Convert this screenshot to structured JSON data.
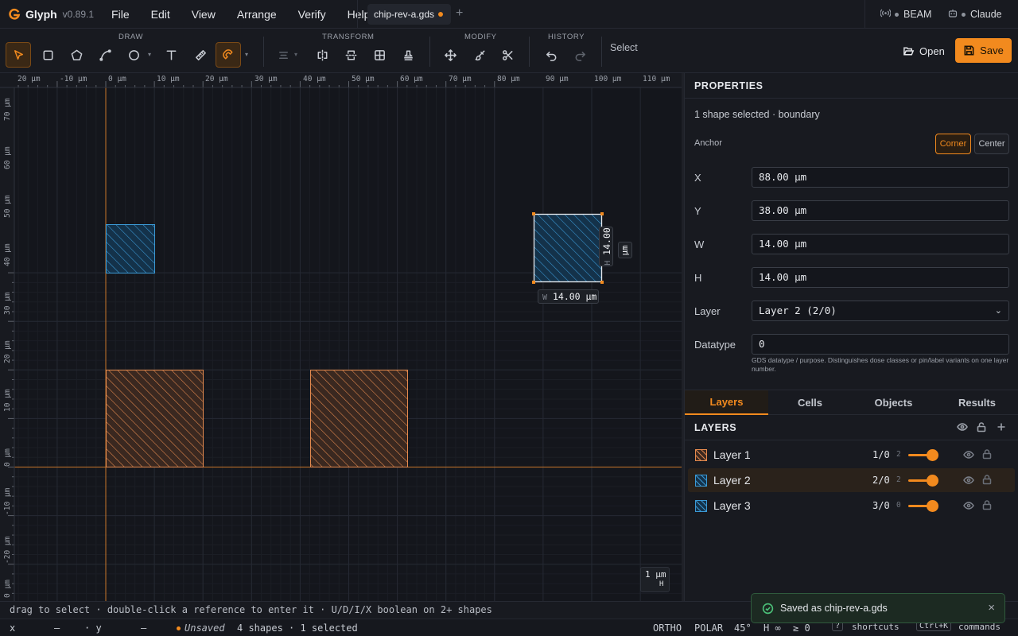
{
  "app": {
    "name": "Glyph",
    "version": "v0.89.1"
  },
  "menu": [
    "File",
    "Edit",
    "View",
    "Arrange",
    "Verify",
    "Help"
  ],
  "file_tab": {
    "name": "chip-rev-a.gds",
    "add": "+"
  },
  "connections": [
    {
      "label": "BEAM",
      "icon": "broadcast-icon"
    },
    {
      "label": "Claude",
      "icon": "robot-icon"
    }
  ],
  "toolbar": {
    "groups": {
      "draw": "DRAW",
      "transform": "TRANSFORM",
      "modify": "MODIFY",
      "history": "HISTORY"
    },
    "mode": "Select",
    "open_label": "Open",
    "save_label": "Save"
  },
  "rulers": {
    "top": [
      "20 µm",
      "-10 µm",
      "0 µm",
      "10 µm",
      "20 µm",
      "30 µm",
      "40 µm",
      "50 µm",
      "60 µm",
      "70 µm",
      "80 µm",
      "90 µm",
      "100 µm",
      "110 µm"
    ],
    "left": [
      "70 µm",
      "60 µm",
      "50 µm",
      "40 µm",
      "30 µm",
      "20 µm",
      "10 µm",
      "0 µm",
      "-10 µm",
      "-20 µm",
      "0 µm"
    ]
  },
  "canvas": {
    "dim_w_prefix": "W",
    "dim_w_value": "14.00 µm",
    "dim_h_prefix": "H",
    "dim_h_value": "14.00",
    "dim_h_unit": "µm",
    "scale_value": "1 µm",
    "scale_axis": "H"
  },
  "properties": {
    "title": "PROPERTIES",
    "selection": "1 shape selected · boundary",
    "anchor_label": "Anchor",
    "anchor_options": [
      "Corner",
      "Center"
    ],
    "anchor_selected": "Corner",
    "fields": {
      "x_label": "X",
      "x_value": "88.00 µm",
      "y_label": "Y",
      "y_value": "38.00 µm",
      "w_label": "W",
      "w_value": "14.00 µm",
      "h_label": "H",
      "h_value": "14.00 µm",
      "layer_label": "Layer",
      "layer_value": "Layer 2 (2/0)",
      "datatype_label": "Datatype",
      "datatype_value": "0"
    },
    "datatype_help": "GDS datatype / purpose. Distinguishes dose classes or pin/label variants on one layer number."
  },
  "tabs": [
    "Layers",
    "Cells",
    "Objects",
    "Results"
  ],
  "active_tab": "Layers",
  "layers_header": "LAYERS",
  "layers": [
    {
      "name": "Layer 1",
      "code": "1/0",
      "count": "2",
      "opacity": 1.0,
      "color": "#e58a4e"
    },
    {
      "name": "Layer 2",
      "code": "2/0",
      "count": "2",
      "opacity": 1.0,
      "color": "#3b9ad6",
      "selected": true
    },
    {
      "name": "Layer 3",
      "code": "3/0",
      "count": "0",
      "opacity": 1.0,
      "color": "#3b9ad6"
    }
  ],
  "hint": "drag to select · double-click a reference to enter it · U/D/I/X boolean on 2+ shapes",
  "status": {
    "x_label": "x",
    "x_value": "—",
    "y_label": "· y",
    "y_value": "—",
    "unsaved": "Unsaved",
    "summary": "4 shapes · 1 selected",
    "ortho": "ORTHO",
    "polar": "POLAR",
    "angle": "45°",
    "h_inf": "H ∞",
    "ge0": "≥ 0",
    "shortcut_key": "?",
    "shortcut_label": "shortcuts",
    "commands_key": "Ctrl+K",
    "commands_label": "commands"
  },
  "toast": {
    "message": "Saved as chip-rev-a.gds",
    "close": "×"
  },
  "colors": {
    "accent": "#f28a1e",
    "layer1": "#e58a4e",
    "layer2": "#3b9ad6",
    "success": "#4cc37a"
  }
}
